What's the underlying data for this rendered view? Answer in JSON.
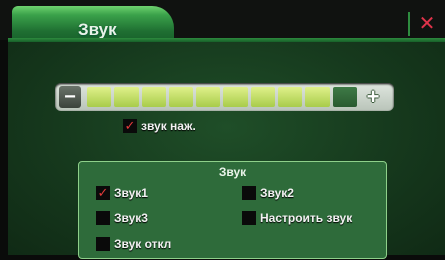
{
  "window": {
    "tab_title": "Звук",
    "close_glyph": "✕"
  },
  "volume": {
    "minus_label": "−",
    "plus_label": "+",
    "segments_total": 10,
    "segments_filled": 9,
    "level_fraction": 0.9
  },
  "key_sound": {
    "label": "звук наж.",
    "checked": true
  },
  "sound_group": {
    "title": "Звук",
    "options": [
      {
        "label": "Звук1",
        "checked": true
      },
      {
        "label": "Звук2",
        "checked": false
      },
      {
        "label": "Звук3",
        "checked": false
      },
      {
        "label": "Настроить звук",
        "checked": false
      },
      {
        "label": "Звук откл",
        "checked": false
      }
    ]
  },
  "colors": {
    "accent": "#2e8c3f",
    "close": "#e0334a",
    "check": "#e13a3a"
  },
  "icons": {
    "close": "close-icon",
    "check": "checkmark-icon"
  }
}
